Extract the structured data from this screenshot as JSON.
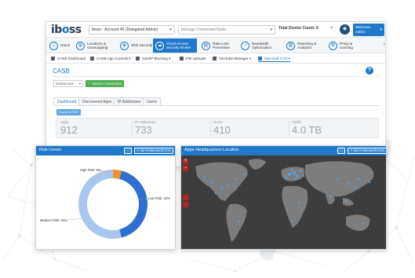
{
  "topbar": {
    "logo_prefix": "ib",
    "logo_mid": "o",
    "logo_suffix": "ss",
    "account_select": "Iboss - Account-45 (Delegated Admin)",
    "manage_select": "Manage Connected Node",
    "device_count": "Total Device Count: 6",
    "user_line1": "Welcome,",
    "user_line2": "Admin"
  },
  "nav": {
    "items": [
      {
        "label": "Home",
        "icon": "home-icon"
      },
      {
        "label": "Locations & Geomapping",
        "icon": "globe-icon"
      },
      {
        "label": "Web Security",
        "icon": "shield-icon"
      },
      {
        "label": "Cloud Access Security Broker",
        "icon": "cloud-icon"
      },
      {
        "label": "Data Loss Prevention",
        "icon": "document-icon"
      },
      {
        "label": "Bandwidth Optimization",
        "icon": "gauge-icon"
      },
      {
        "label": "Reporting & Analytics",
        "icon": "chart-icon"
      },
      {
        "label": "Proxy & Caching",
        "icon": "gear-icon"
      }
    ]
  },
  "subnav": {
    "items": [
      "CASB Dashboard",
      "CASB App Controls ▾",
      "Geo/IP Blocking ▾",
      "File Uploads",
      "YouTube Manager ▾",
      "Microsoft CAS ▾"
    ]
  },
  "page": {
    "title": "CASB",
    "global_select": "Global view",
    "service_badge": "✓ Service Connected",
    "export_label": "Export to PDF",
    "tabs": [
      "Dashboard",
      "Discovered Apps",
      "IP Addresses",
      "Users"
    ]
  },
  "stats": [
    {
      "label": "Apps",
      "value": "912"
    },
    {
      "label": "IP Addresses",
      "value": "733"
    },
    {
      "label": "Users",
      "value": "410"
    },
    {
      "label": "Traffic",
      "value": "4.0 TB"
    }
  ],
  "risk_panel": {
    "title": "Risk Levels",
    "go_label": "Go To Microsoft CAS"
  },
  "map_panel": {
    "title": "Apps Headquarters Location",
    "go_label": "Go To Microsoft CAS",
    "zoom_in": "+",
    "zoom_out": "−"
  },
  "chart_data": {
    "type": "pie",
    "variant": "donut",
    "categories": [
      "High Risk",
      "Low Risk",
      "Medium Risk"
    ],
    "values": [
      4,
      42,
      54
    ],
    "labels": [
      "High Risk: 4%",
      "Low Risk: 42%",
      "Medium Risk: 54%"
    ],
    "colors": [
      "#f0922b",
      "#2e6fd1",
      "#a9c6ef"
    ]
  },
  "colors": {
    "accent": "#1f78c9",
    "service_ok": "#4caf50",
    "map_bg": "#3d3d3d",
    "land": "#7d7d7d"
  }
}
